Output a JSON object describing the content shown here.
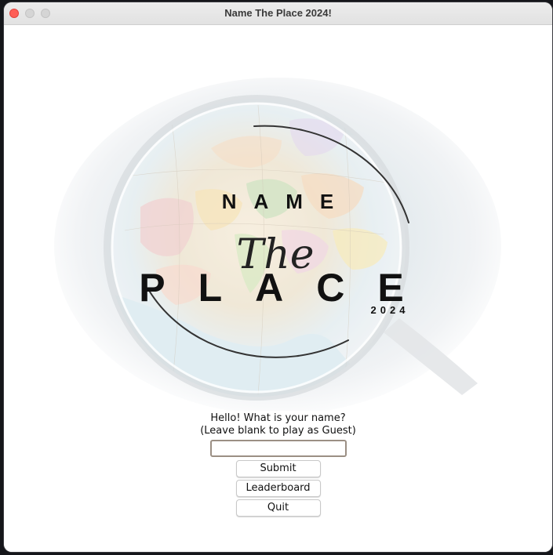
{
  "window": {
    "title": "Name The Place 2024!"
  },
  "logo": {
    "word_top": "NAME",
    "word_script": "The",
    "word_main": "PLACE",
    "year": "2024"
  },
  "form": {
    "prompt_line1": "Hello! What is your name?",
    "prompt_line2": "(Leave blank to play as Guest)",
    "name_value": "",
    "submit_label": "Submit",
    "leaderboard_label": "Leaderboard",
    "quit_label": "Quit"
  },
  "colors": {
    "close_button": "#fe5f57",
    "window_background": "#ffffff",
    "logo_text": "#111111"
  }
}
